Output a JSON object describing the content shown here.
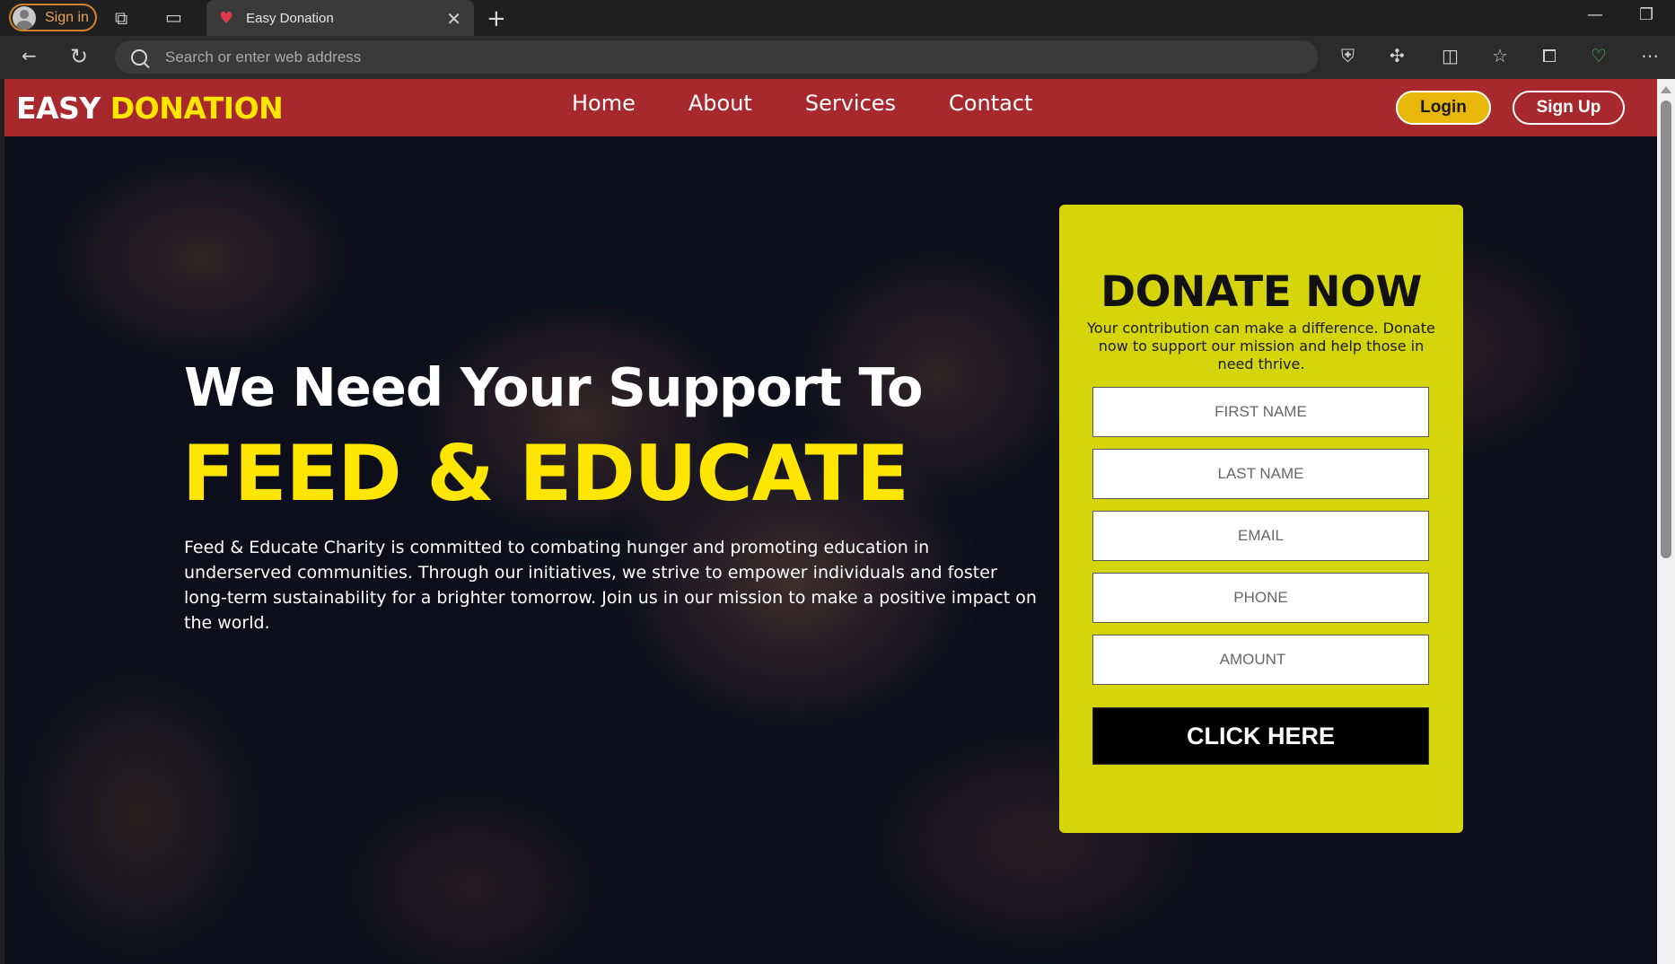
{
  "browser": {
    "signin_label": "Sign in",
    "tab_title": "Easy Donation",
    "address_placeholder": "Search or enter web address"
  },
  "nav": {
    "logo_part1": "EASY",
    "logo_part2": "DONATION",
    "links": [
      "Home",
      "About",
      "Services",
      "Contact"
    ],
    "login_label": "Login",
    "signup_label": "Sign Up"
  },
  "hero": {
    "headline": "We Need Your Support To",
    "highlight": "FEED & EDUCATE",
    "description": "Feed & Educate Charity is committed to combating hunger and promoting education in underserved communities. Through our initiatives, we strive to empower individuals and foster long-term sustainability for a brighter tomorrow. Join us in our mission to make a positive impact on the world."
  },
  "donate": {
    "title": "DONATE NOW",
    "subtitle": "Your contribution can make a difference. Donate now to support our mission and help those in need thrive.",
    "fields": {
      "first_name": "FIRST NAME",
      "last_name": "LAST NAME",
      "email": "EMAIL",
      "phone": "PHONE",
      "amount": "AMOUNT"
    },
    "button_label": "CLICK HERE"
  },
  "colors": {
    "navbar": "#a8292d",
    "accent_yellow": "#ffe600",
    "card": "#d6d40a",
    "login_button": "#e8b70a"
  }
}
